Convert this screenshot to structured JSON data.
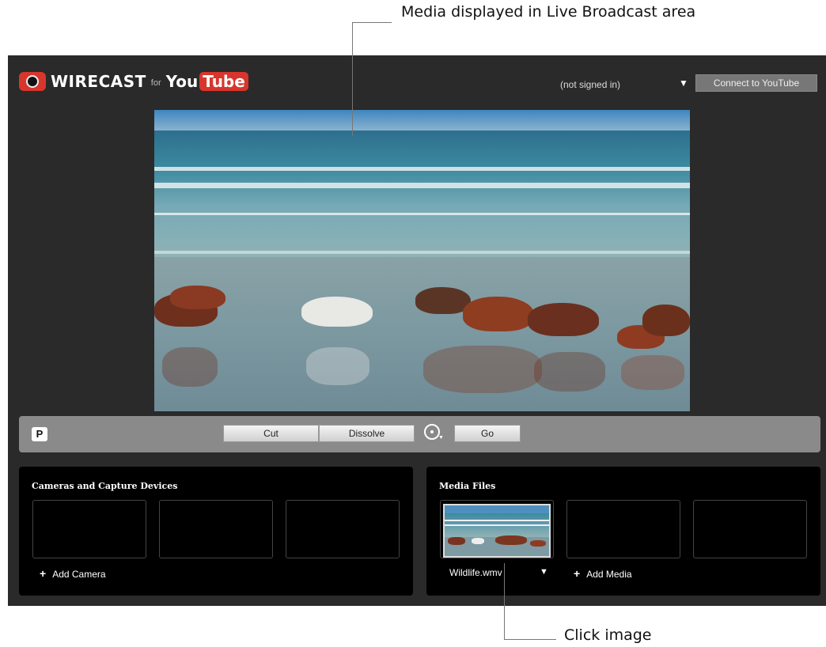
{
  "annotations": {
    "top": "Media displayed in Live Broadcast area",
    "bottom": "Click image"
  },
  "header": {
    "brand": "WIRECAST",
    "for_text": "for",
    "partner_you": "You",
    "partner_tube": "Tube",
    "signed_in_status": "(not signed in)",
    "connect_label": "Connect to YouTube"
  },
  "switcher": {
    "preview_toggle": "P",
    "cut_label": "Cut",
    "dissolve_label": "Dissolve",
    "go_label": "Go"
  },
  "cameras": {
    "title": "Cameras and Capture Devices",
    "add_label": "Add Camera"
  },
  "media": {
    "title": "Media Files",
    "file_name": "Wildlife.wmv",
    "add_label": "Add Media"
  },
  "colors": {
    "accent_red": "#d7362c",
    "app_background": "#2a2a2a",
    "panel_background": "#000000"
  }
}
